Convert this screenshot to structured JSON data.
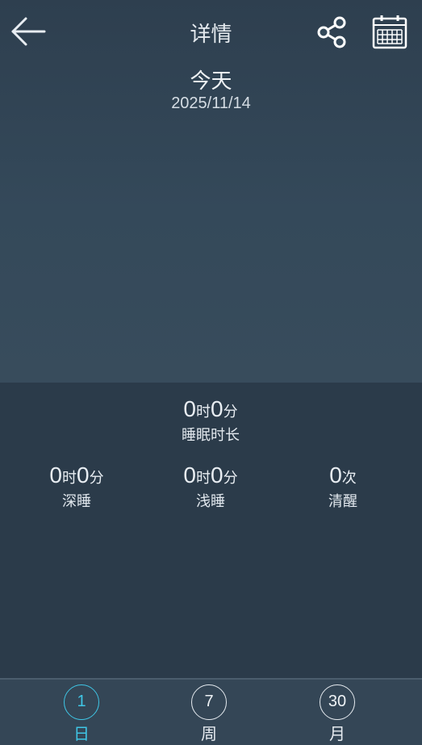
{
  "header": {
    "title": "详情",
    "back_icon": "arrow-left-icon",
    "share_icon": "share-icon",
    "calendar_icon": "calendar-icon"
  },
  "period": {
    "label": "今天",
    "date": "2025/11/14"
  },
  "summary": {
    "total": {
      "hours": "0",
      "hour_unit": "时",
      "minutes": "0",
      "minute_unit": "分",
      "label": "睡眠时长"
    },
    "deep": {
      "hours": "0",
      "hour_unit": "时",
      "minutes": "0",
      "minute_unit": "分",
      "label": "深睡"
    },
    "light": {
      "hours": "0",
      "hour_unit": "时",
      "minutes": "0",
      "minute_unit": "分",
      "label": "浅睡"
    },
    "awake": {
      "count": "0",
      "count_unit": "次",
      "label": "清醒"
    }
  },
  "nav": {
    "items": [
      {
        "number": "1",
        "label": "日"
      },
      {
        "number": "7",
        "label": "周"
      },
      {
        "number": "30",
        "label": "月"
      }
    ],
    "active_color": "#3fc6e6"
  },
  "colors": {
    "header_bg": "#34495a",
    "stats_bg": "#2b3b4a",
    "nav_bg": "#344656"
  }
}
